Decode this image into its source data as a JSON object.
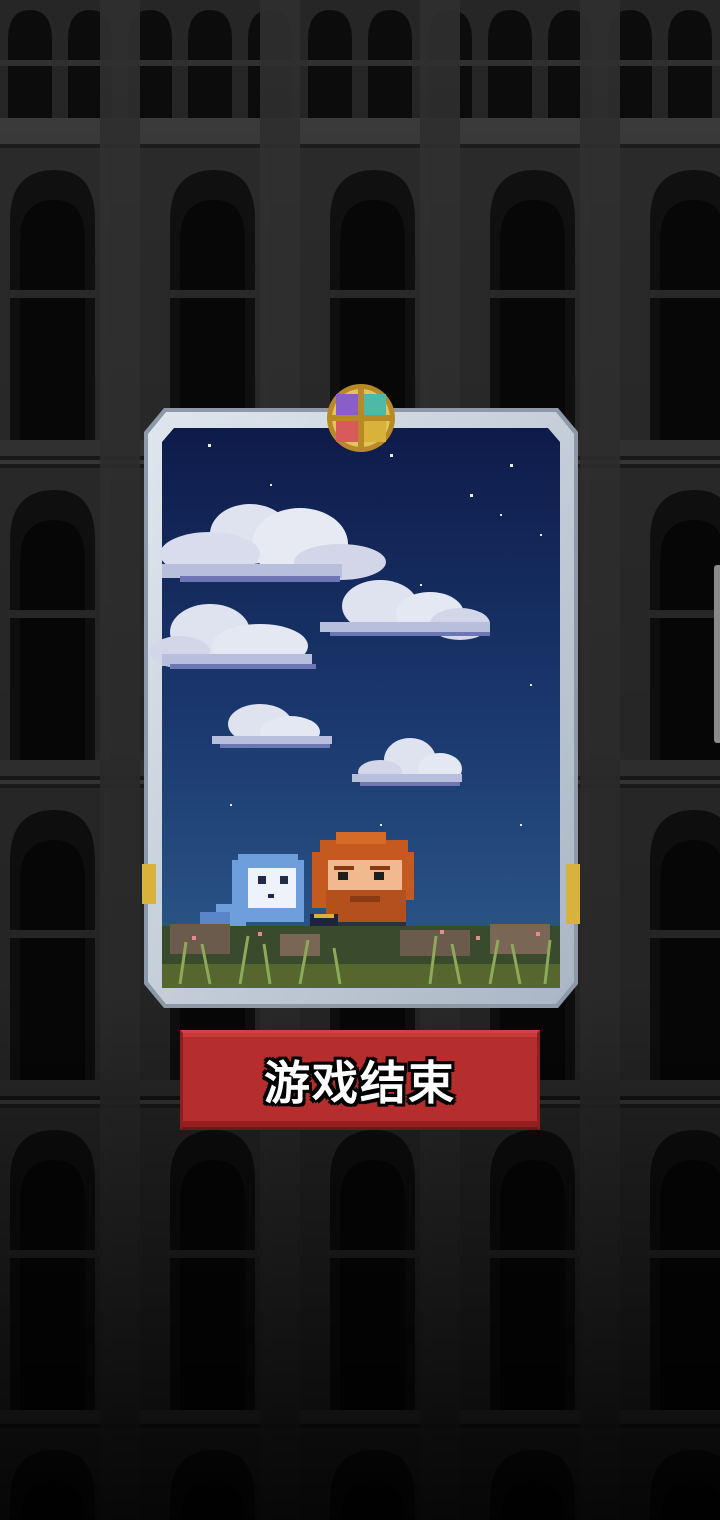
{
  "screen": {
    "name": "game-over-card-screen"
  },
  "card": {
    "scene": "night-sky-with-clouds",
    "characters": [
      "bearded-red-haired-hero",
      "blue-ghost-spirit"
    ],
    "emblem_icon": "four-quadrant-gem-emblem-icon"
  },
  "button": {
    "game_over_label": "游戏结束"
  },
  "colors": {
    "button_red": "#b52d2d",
    "sky_top": "#0e1b4a",
    "sky_bottom": "#2e5a8c",
    "frame_silver": "#c9d3df",
    "background_dark": "#161616"
  }
}
